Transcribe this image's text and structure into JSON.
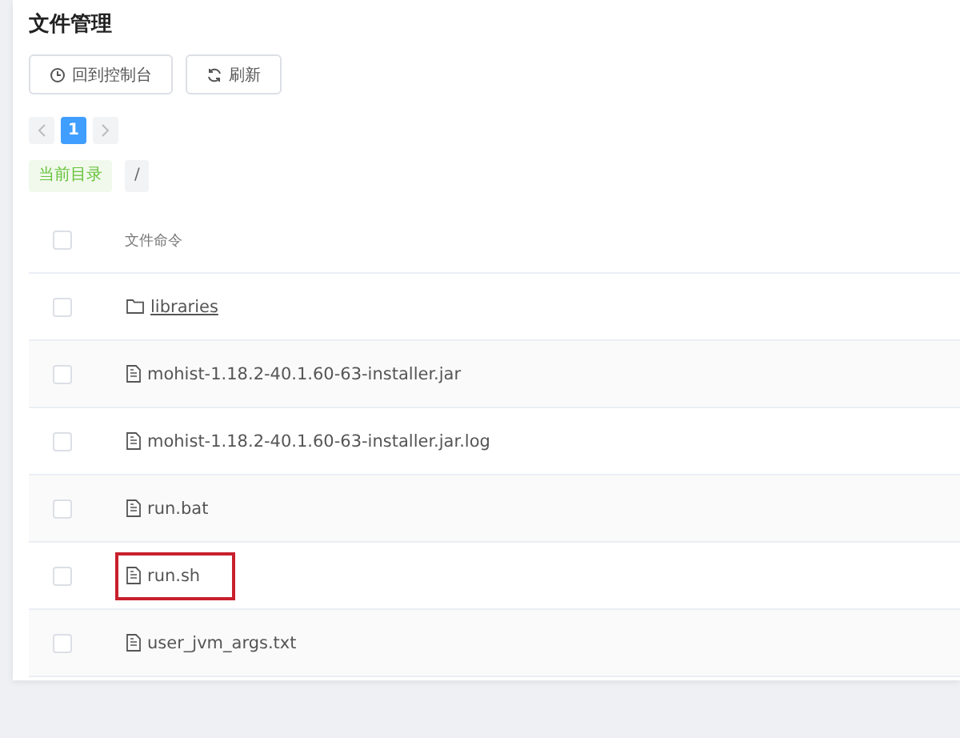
{
  "title": "文件管理",
  "toolbar": [
    {
      "label": "回到控制台",
      "kind": "console"
    },
    {
      "label": "刷新",
      "kind": "refresh"
    }
  ],
  "pagination": {
    "pages": [
      {
        "label": "1",
        "selected": true
      }
    ]
  },
  "breadcrumb": {
    "label": "当前目录",
    "path": "/"
  },
  "table": {
    "header": {
      "checked": false,
      "column": "文件命令"
    },
    "rows": [
      {
        "kind": "folder",
        "name": "libraries",
        "checked": false,
        "highlighted": false
      },
      {
        "kind": "file",
        "name": "mohist-1.18.2-40.1.60-63-installer.jar",
        "checked": false,
        "highlighted": false
      },
      {
        "kind": "file",
        "name": "mohist-1.18.2-40.1.60-63-installer.jar.log",
        "checked": false,
        "highlighted": false
      },
      {
        "kind": "file",
        "name": "run.bat",
        "checked": false,
        "highlighted": false
      },
      {
        "kind": "file",
        "name": "run.sh",
        "checked": false,
        "highlighted": true
      },
      {
        "kind": "file",
        "name": "user_jvm_args.txt",
        "checked": false,
        "highlighted": false
      }
    ]
  }
}
